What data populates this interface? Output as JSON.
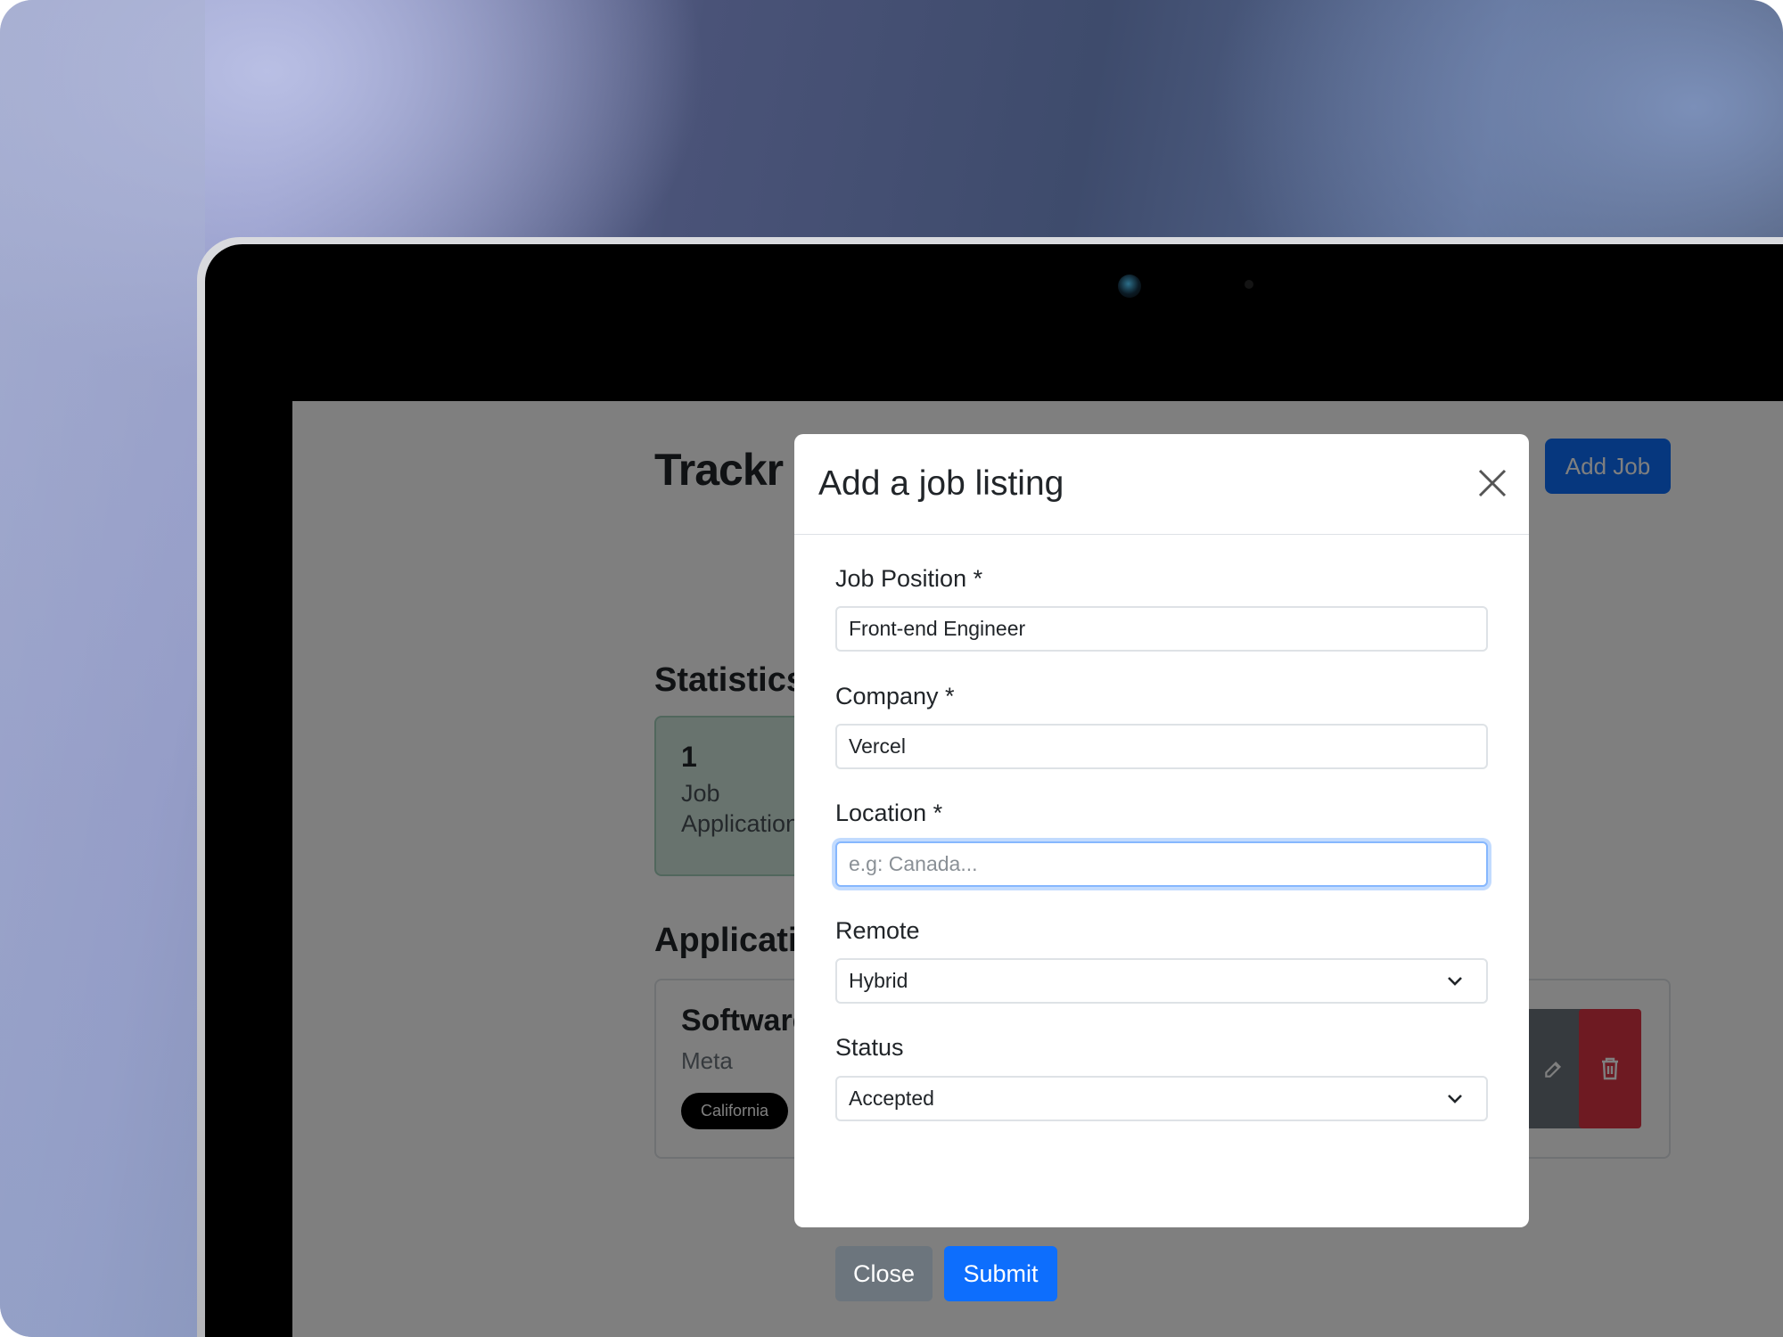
{
  "app": {
    "title": "Trackr",
    "add_job_label": "Add Job"
  },
  "statistics": {
    "heading": "Statistics",
    "cards": [
      {
        "value": "1",
        "label": "Job Applications"
      }
    ]
  },
  "applications": {
    "heading": "Applications",
    "items": [
      {
        "position": "Software",
        "company": "Meta",
        "location": "California"
      }
    ]
  },
  "modal": {
    "title": "Add a job listing",
    "fields": {
      "job_position": {
        "label": "Job Position *",
        "value": "Front-end Engineer"
      },
      "company": {
        "label": "Company *",
        "value": "Vercel"
      },
      "location": {
        "label": "Location *",
        "value": "",
        "placeholder": "e.g: Canada..."
      },
      "remote": {
        "label": "Remote",
        "selected": "Hybrid"
      },
      "status": {
        "label": "Status",
        "selected": "Accepted"
      }
    },
    "close_label": "Close",
    "submit_label": "Submit"
  },
  "colors": {
    "primary": "#0d6efd",
    "secondary": "#6c757d",
    "danger": "#dc3545",
    "success_bg": "#d1e7dd"
  }
}
